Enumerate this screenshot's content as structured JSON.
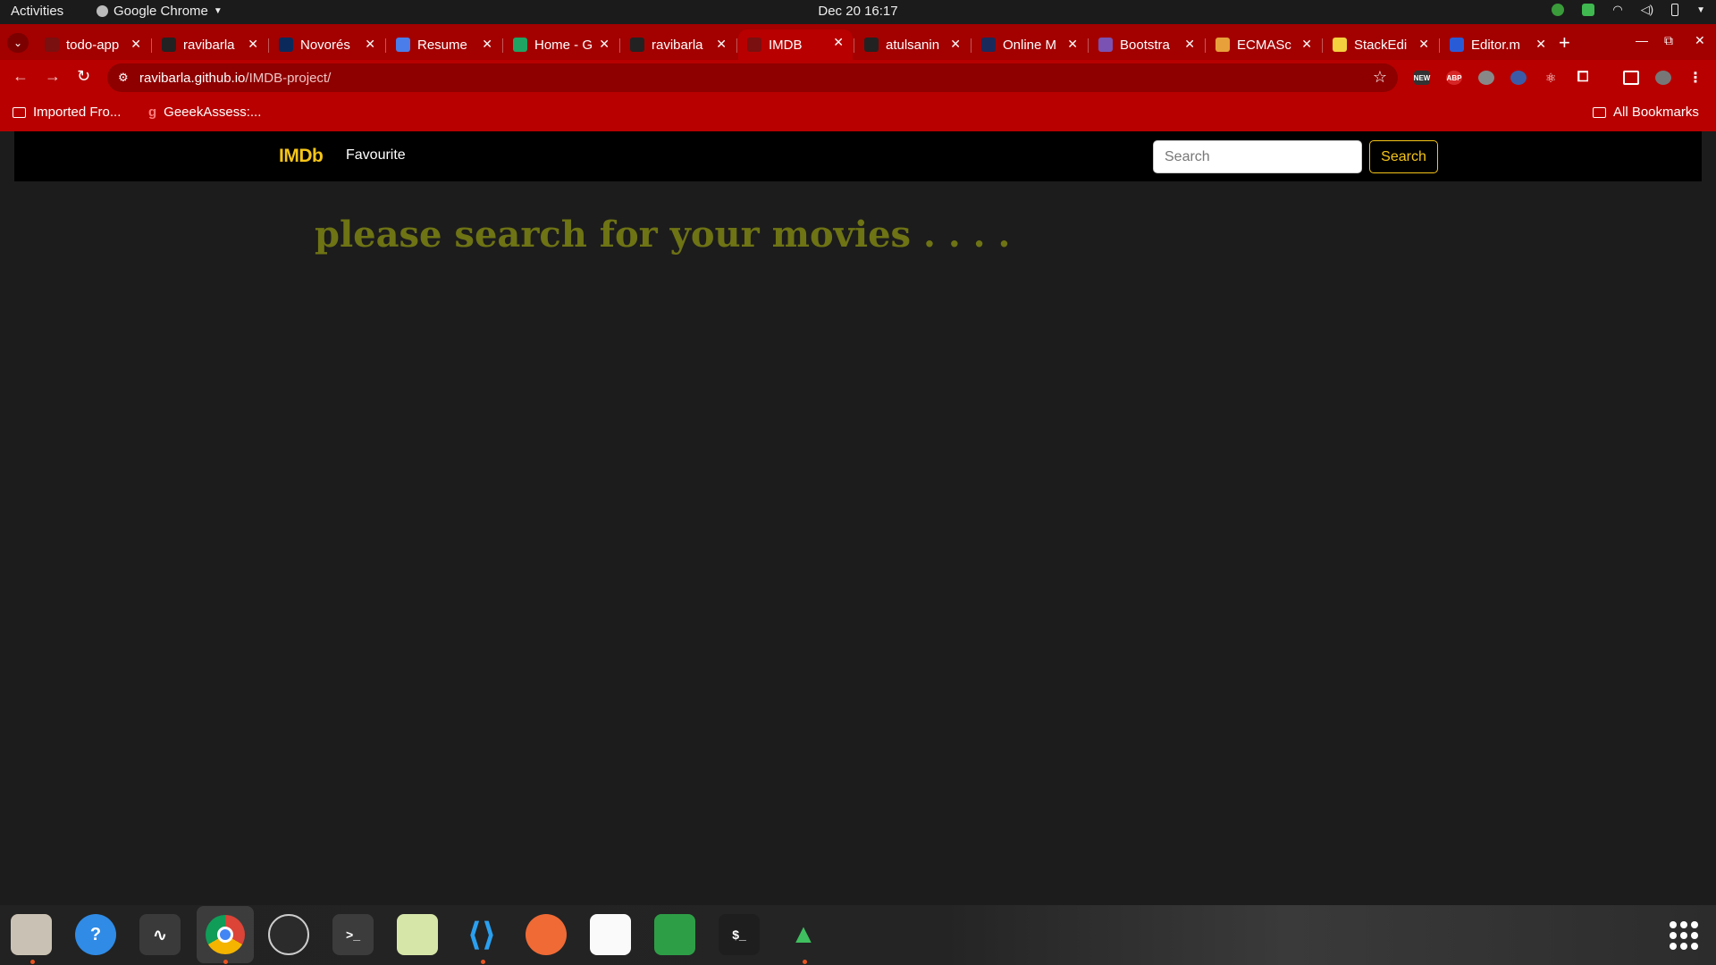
{
  "topbar": {
    "activities": "Activities",
    "app": "Google Chrome",
    "clock": "Dec 20  16:17"
  },
  "tabs": [
    {
      "title": "todo-app",
      "fav_color": "#7a1010",
      "icon": "globe-icon"
    },
    {
      "title": "ravibarla",
      "fav_color": "#222222",
      "icon": "github-icon"
    },
    {
      "title": "Novorés",
      "fav_color": "#0b2a5b",
      "icon": "novoresume-icon"
    },
    {
      "title": "Resume",
      "fav_color": "#4a7dea",
      "icon": "docs-icon"
    },
    {
      "title": "Home - G",
      "fav_color": "#1fa463",
      "icon": "drive-icon"
    },
    {
      "title": "ravibarla",
      "fav_color": "#222222",
      "icon": "github-icon"
    },
    {
      "title": "IMDB",
      "fav_color": "#7a1010",
      "icon": "globe-icon"
    },
    {
      "title": "atulsanin",
      "fav_color": "#222222",
      "icon": "github-icon"
    },
    {
      "title": "Online M",
      "fav_color": "#1a2a5a",
      "icon": "d-icon"
    },
    {
      "title": "Bootstra",
      "fav_color": "#7952b3",
      "icon": "bootstrap-icon"
    },
    {
      "title": "ECMASc",
      "fav_color": "#e8a13a",
      "icon": "ecma-icon"
    },
    {
      "title": "StackEdi",
      "fav_color": "#f4d03f",
      "icon": "stackedit-icon"
    },
    {
      "title": "Editor.m",
      "fav_color": "#2a5bd7",
      "icon": "editor-icon"
    }
  ],
  "address": {
    "host": "ravibarla.github.io",
    "path": "/IMDB-project/"
  },
  "bookmarks": {
    "left": [
      {
        "label": "Imported Fro..."
      },
      {
        "label": "GeeekAssess:..."
      }
    ],
    "right": "All Bookmarks"
  },
  "site": {
    "brand": "IMDb",
    "nav_link": "Favourite",
    "search_placeholder": "Search",
    "search_button": "Search",
    "headline": "please search for your movies . . . ."
  },
  "colors": {
    "chrome_frame": "#b80000",
    "imdb_yellow": "#f5c518",
    "headline": "#6e7314"
  }
}
